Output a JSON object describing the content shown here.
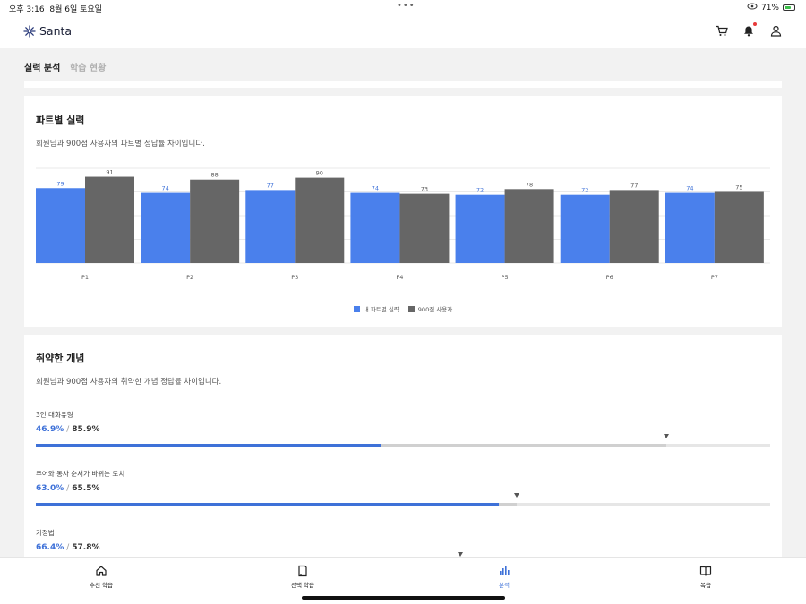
{
  "status_bar": {
    "time": "오후 3:16",
    "date": "8월 6일 토요일",
    "battery": "71%",
    "battery_level": 0.71
  },
  "header": {
    "logo_text": "Santa"
  },
  "tabs": [
    {
      "label": "실력 분석",
      "active": true
    },
    {
      "label": "학습 현황",
      "active": false
    }
  ],
  "part_section": {
    "title": "파트별 실력",
    "description": "회원님과 900점 사용자의 파트별 정답률 차이입니다."
  },
  "chart_data": {
    "type": "bar",
    "categories": [
      "P1",
      "P2",
      "P3",
      "P4",
      "P5",
      "P6",
      "P7"
    ],
    "series": [
      {
        "name": "내 파트별 실력",
        "values": [
          79,
          74,
          77,
          74,
          72,
          72,
          74
        ],
        "color": "#4a80ec",
        "label_color": "#3e71d8"
      },
      {
        "name": "900점 사용자",
        "values": [
          91,
          88,
          90,
          73,
          78,
          77,
          75
        ],
        "color": "#666666",
        "label_color": "#555555"
      }
    ],
    "ylim": [
      0,
      100
    ],
    "grid": true,
    "legend": "bottom-center"
  },
  "concept_section": {
    "title": "취약한 개념",
    "description": "회원님과 900점 사용자의 취약한 개념 정답률 차이입니다.",
    "items": [
      {
        "name": "3인 대화유형",
        "mine": "46.9%",
        "other": "85.9%",
        "mine_value": 46.9,
        "other_value": 85.9
      },
      {
        "name": "주어와 동사 순서가 바뀌는 도치",
        "mine": "63.0%",
        "other": "65.5%",
        "mine_value": 63.0,
        "other_value": 65.5
      },
      {
        "name": "가정법",
        "mine": "66.4%",
        "other": "57.8%",
        "mine_value": 66.4,
        "other_value": 57.8
      }
    ],
    "separator": "/"
  },
  "bottom_nav": [
    {
      "label": "추천 학습",
      "icon": "home-icon",
      "active": false
    },
    {
      "label": "선택 학습",
      "icon": "book-page-icon",
      "active": false
    },
    {
      "label": "분석",
      "icon": "chart-bars-icon",
      "active": true
    },
    {
      "label": "복습",
      "icon": "open-book-icon",
      "active": false
    }
  ]
}
